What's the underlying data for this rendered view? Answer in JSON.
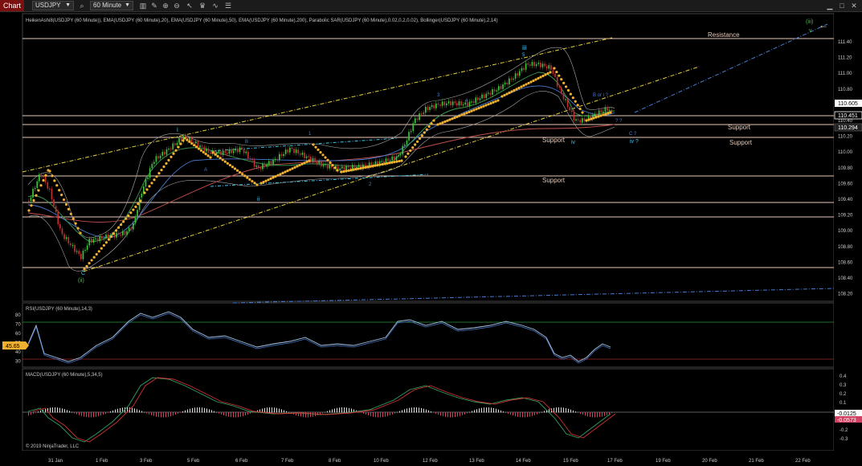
{
  "toolbar": {
    "tab_label": "Chart",
    "instrument": "USDJPY",
    "interval": "60 Minute"
  },
  "price_panel": {
    "indicators_label": "HeikenAshi8(USDJPY (60 Minute)), EMA(USDJPY (60 Minute),20), EMA(USDJPY (60 Minute),50), EMA(USDJPY (60 Minute),200), Parabolic SAR(USDJPY (60 Minute),0.02,0.2,0.02), Bollinger(USDJPY (60 Minute),2,14)",
    "y_ticks": [
      "111.40",
      "111.20",
      "111.00",
      "110.80",
      "110.60",
      "110.40",
      "110.20",
      "110.00",
      "109.80",
      "109.60",
      "109.40",
      "109.20",
      "109.00",
      "108.80",
      "108.60",
      "108.40",
      "108.20"
    ],
    "price_tags": [
      {
        "value": "110.605",
        "style": "white"
      },
      {
        "value": "110.451",
        "style": "black"
      },
      {
        "value": "110.294",
        "style": "dark"
      }
    ],
    "annotations": {
      "resistance": "Resistance",
      "support_1": "Support",
      "support_2": "Support",
      "support_3": "Support",
      "support_4": "Support",
      "wave_iii": "iii",
      "wave_iii_5": "5",
      "wave_i": "i",
      "wave_ii": "ii",
      "wave_iv": "iv",
      "wave_iv_q": "iv ?",
      "wave_c_q": "C ?",
      "wave_bi_q": "B or i ?",
      "wave_qq": "? ?",
      "wave_ii_green": "(ii)",
      "wave_iii_green": "(iii)",
      "wave_v_green": "v",
      "wave_c": "C",
      "wave_A": "A",
      "wave_B": "B",
      "wave_1": "1",
      "wave_2": "2",
      "wave_3": "3",
      "wave_4": "4"
    }
  },
  "rsi_panel": {
    "label": "RSI(USDJPY (60 Minute),14,3)",
    "y_ticks": [
      "80",
      "70",
      "60",
      "50",
      "40",
      "30"
    ],
    "value_tag": "45.65"
  },
  "macd_panel": {
    "label": "MACD(USDJPY (60 Minute),5,34,5)",
    "y_ticks": [
      "0.4",
      "0.3",
      "0.2",
      "0.1",
      "-0.1",
      "-0.2",
      "-0.3"
    ],
    "value_tags": [
      "-0.0125",
      "-0.0573"
    ],
    "copyright": "© 2019 NinjaTrader, LLC"
  },
  "x_axis": {
    "labels": [
      "31 Jan",
      "1 Feb",
      "3 Feb",
      "5 Feb",
      "6 Feb",
      "7 Feb",
      "8 Feb",
      "10 Feb",
      "12 Feb",
      "13 Feb",
      "14 Feb",
      "15 Feb",
      "17 Feb",
      "19 Feb",
      "20 Feb",
      "21 Feb",
      "22 Feb"
    ]
  },
  "colors": {
    "background": "#000000",
    "sar": "#f0b030",
    "trendline": "#e8d23a",
    "support_line": "#e7c9b8",
    "ema_red": "#c0504d",
    "ema_blue": "#4a7bd0",
    "cyan_label": "#3fc3ee",
    "green_label": "#3cc23c",
    "rsi_line": "#a9c8e8",
    "macd_line": "#30a060",
    "macd_signal": "#d03030"
  }
}
